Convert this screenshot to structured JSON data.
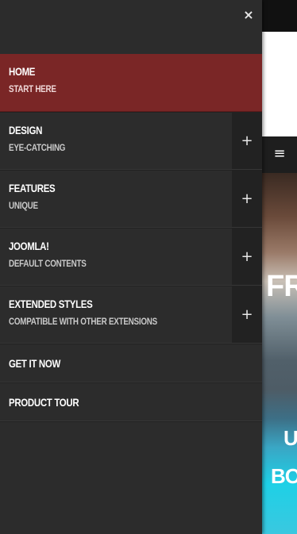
{
  "sidebar": {
    "close_icon": "×",
    "items": [
      {
        "title": "HOME",
        "subtitle": "START HERE",
        "active": true,
        "expandable": false
      },
      {
        "title": "DESIGN",
        "subtitle": "EYE-CATCHING",
        "active": false,
        "expandable": true,
        "expand_icon": "+"
      },
      {
        "title": "FEATURES",
        "subtitle": "UNIQUE",
        "active": false,
        "expandable": true,
        "expand_icon": "+"
      },
      {
        "title": "JOOMLA!",
        "subtitle": "DEFAULT CONTENTS",
        "active": false,
        "expandable": true,
        "expand_icon": "+"
      },
      {
        "title": "EXTENDED STYLES",
        "subtitle": "COMPATIBLE WITH OTHER EXTENSIONS",
        "active": false,
        "expandable": true,
        "expand_icon": "+"
      },
      {
        "title": "GET IT NOW",
        "active": false,
        "expandable": false
      },
      {
        "title": "PRODUCT TOUR",
        "active": false,
        "expandable": false
      }
    ]
  },
  "page": {
    "menu_toggle_icon": "≡",
    "hero": {
      "line1": "FR",
      "line2": "U",
      "line3": "BO"
    }
  },
  "colors": {
    "sidebar_bg": "#2c2c2c",
    "active_bg": "#7a2626",
    "expand_bg": "#222222"
  }
}
